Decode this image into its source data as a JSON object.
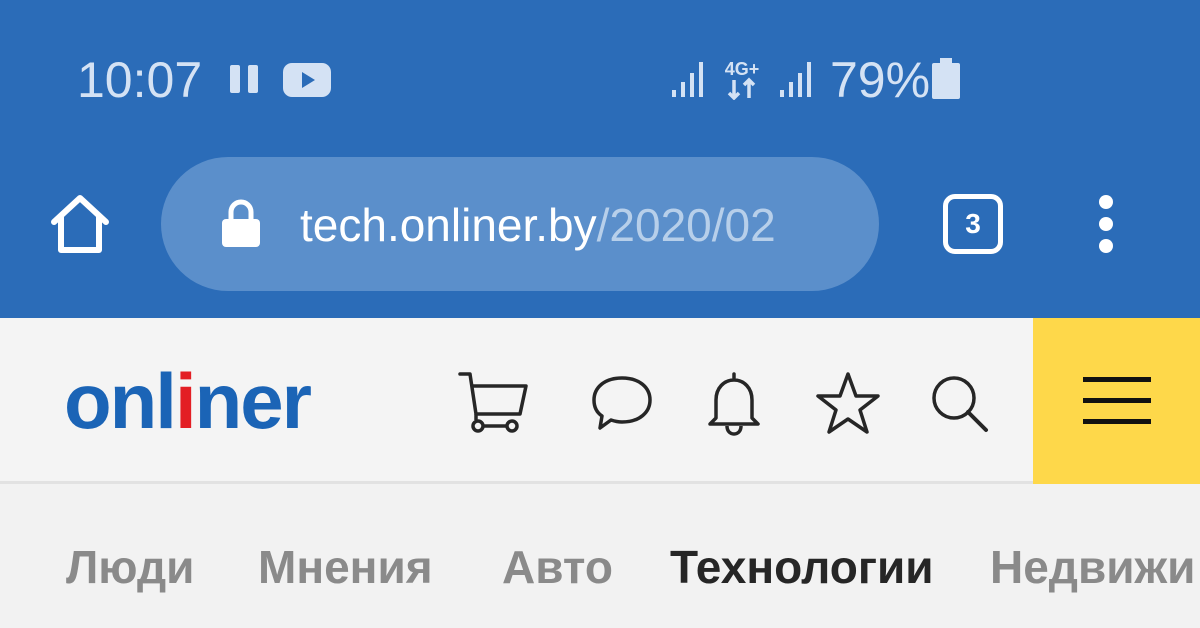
{
  "status_bar": {
    "time": "10:07",
    "network_type": "4G+",
    "battery_percent": "79%",
    "icons": [
      "pause-icon",
      "youtube-icon",
      "signal-icon",
      "network-4g-icon",
      "signal-icon",
      "battery-icon"
    ]
  },
  "browser": {
    "url_host": "tech.onliner.by",
    "url_path": "/2020/02",
    "tab_count": "3",
    "icons": [
      "home-icon",
      "lock-icon",
      "tabs-icon",
      "more-vert-icon"
    ]
  },
  "site_header": {
    "logo": {
      "before": "onl",
      "highlight": "i",
      "after": "ner"
    },
    "icons": [
      "cart-icon",
      "chat-icon",
      "bell-icon",
      "star-icon",
      "search-icon",
      "hamburger-menu-icon"
    ],
    "colors": {
      "logo_blue": "#1b64b6",
      "logo_red": "#e31e24",
      "menu_yellow": "#fed84a"
    }
  },
  "section_nav": {
    "items": [
      {
        "label": "Люди",
        "active": false
      },
      {
        "label": "Мнения",
        "active": false
      },
      {
        "label": "Авто",
        "active": false
      },
      {
        "label": "Технологии",
        "active": true
      },
      {
        "label": "Недвижи",
        "active": false
      }
    ]
  },
  "colors": {
    "chrome_blue": "#2b6cb8",
    "url_bar": "#5b8fcb"
  }
}
